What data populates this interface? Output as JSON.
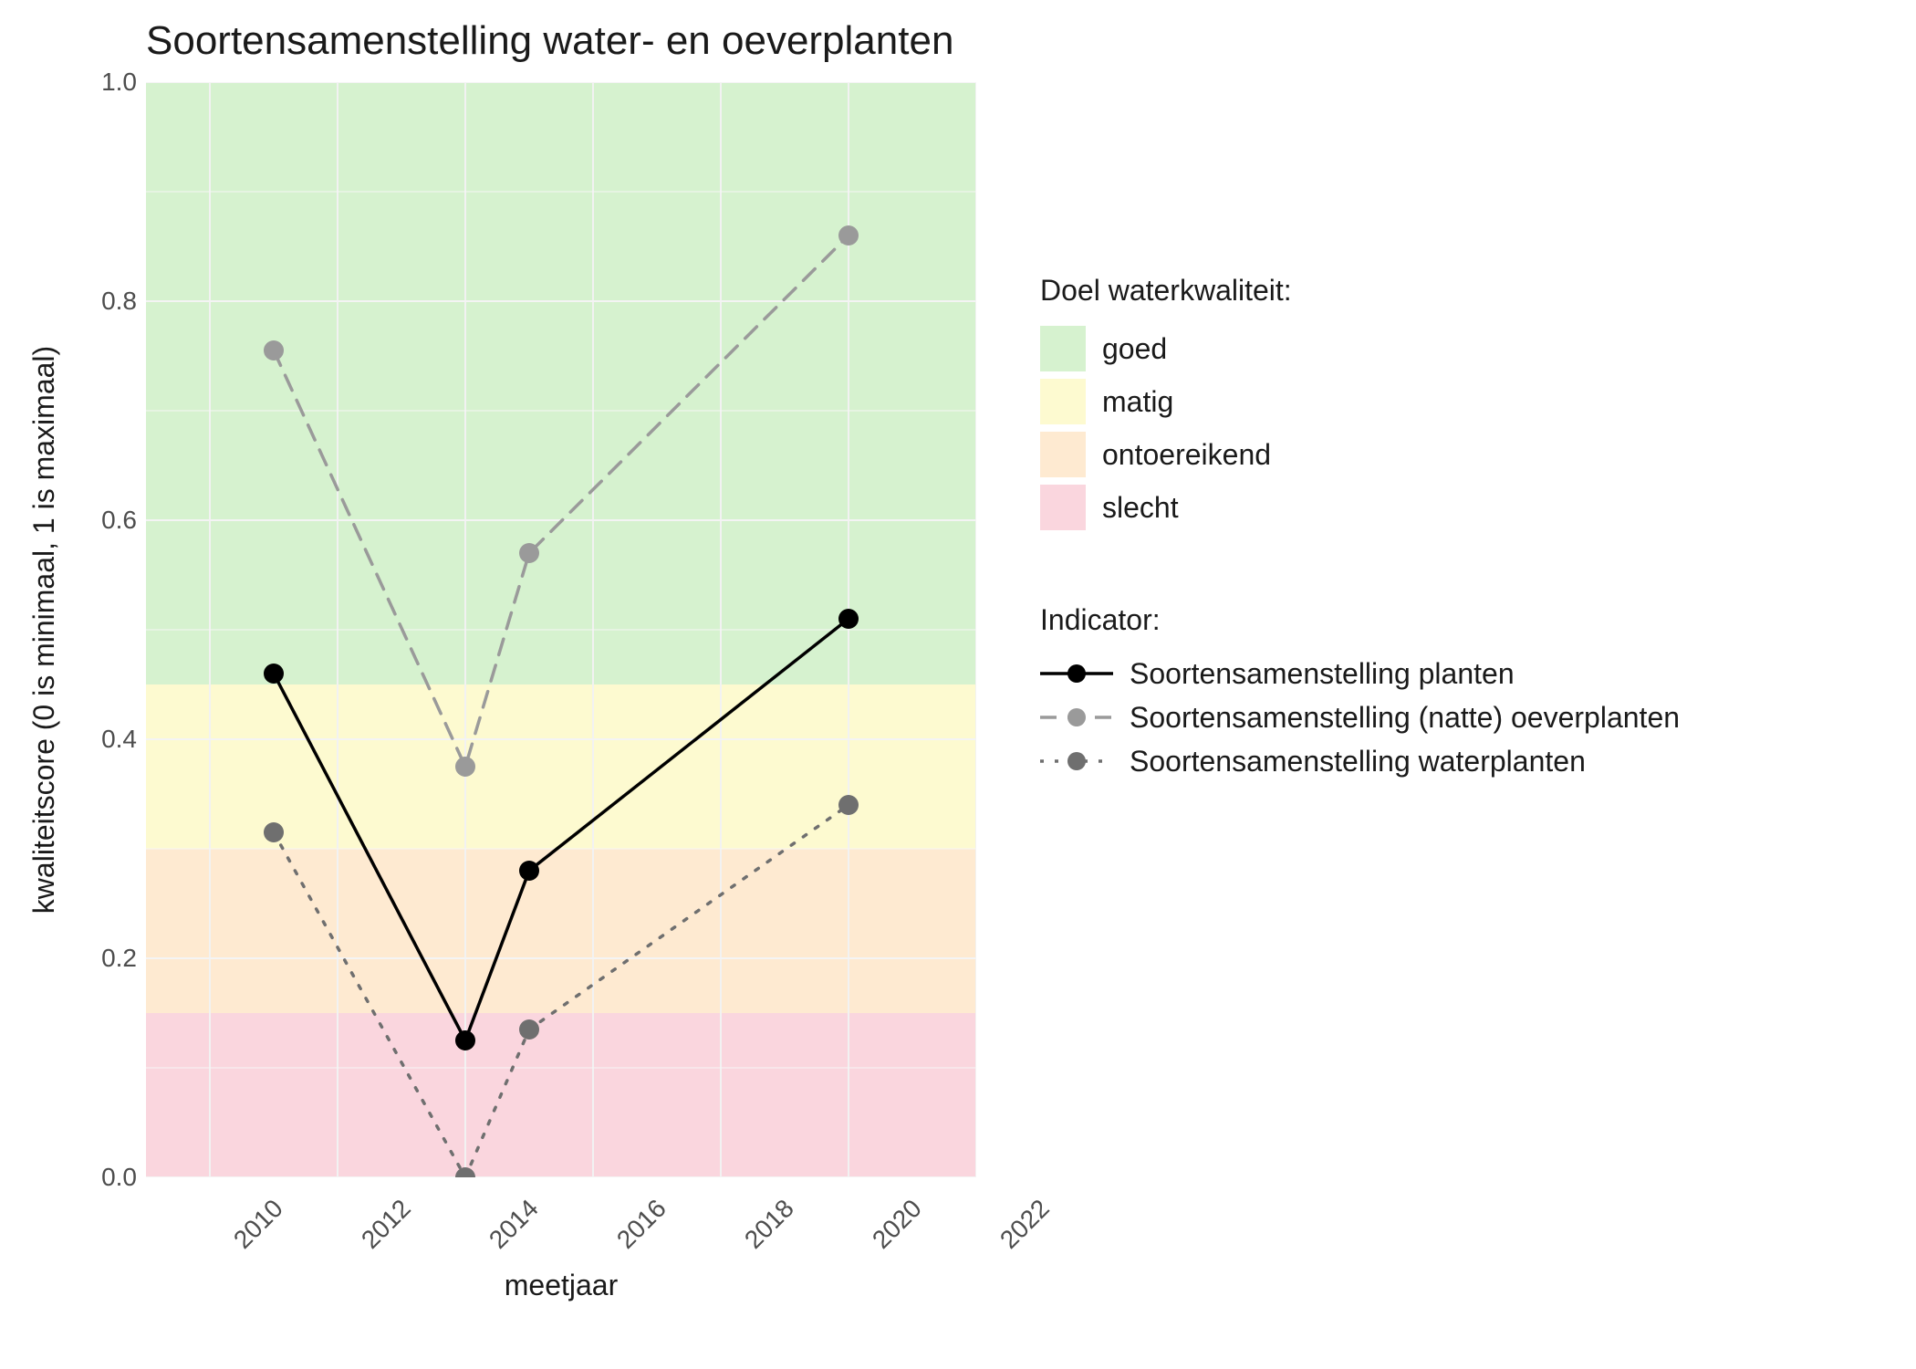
{
  "chart_data": {
    "type": "line",
    "title": "Soortensamenstelling water- en oeverplanten",
    "xlabel": "meetjaar",
    "ylabel": "kwaliteitscore (0 is minimaal, 1 is maximaal)",
    "xlim": [
      2009,
      2022
    ],
    "ylim": [
      0.0,
      1.0
    ],
    "x_ticks": [
      2010,
      2012,
      2014,
      2016,
      2018,
      2020,
      2022
    ],
    "y_ticks": [
      0.0,
      0.2,
      0.4,
      0.6,
      0.8,
      1.0
    ],
    "bands": [
      {
        "name": "goed",
        "from": 0.45,
        "to": 1.0,
        "color": "#d6f2cf"
      },
      {
        "name": "matig",
        "from": 0.3,
        "to": 0.45,
        "color": "#fdfad0"
      },
      {
        "name": "ontoereikend",
        "from": 0.15,
        "to": 0.3,
        "color": "#feead1"
      },
      {
        "name": "slecht",
        "from": 0.0,
        "to": 0.15,
        "color": "#fad6de"
      }
    ],
    "series": [
      {
        "name": "Soortensamenstelling planten",
        "dash": "solid",
        "color": "#000000",
        "x": [
          2011,
          2014,
          2015,
          2020
        ],
        "y": [
          0.46,
          0.125,
          0.28,
          0.51
        ]
      },
      {
        "name": "Soortensamenstelling (natte) oeverplanten",
        "dash": "dashed",
        "color": "#9a9a9a",
        "x": [
          2011,
          2014,
          2015,
          2020
        ],
        "y": [
          0.755,
          0.375,
          0.57,
          0.86
        ]
      },
      {
        "name": "Soortensamenstelling waterplanten",
        "dash": "dotted",
        "color": "#6f6f6f",
        "x": [
          2011,
          2014,
          2015,
          2020
        ],
        "y": [
          0.315,
          0.0,
          0.135,
          0.34
        ]
      }
    ],
    "legend": {
      "bands_title": "Doel waterkwaliteit:",
      "series_title": "Indicator:"
    }
  }
}
